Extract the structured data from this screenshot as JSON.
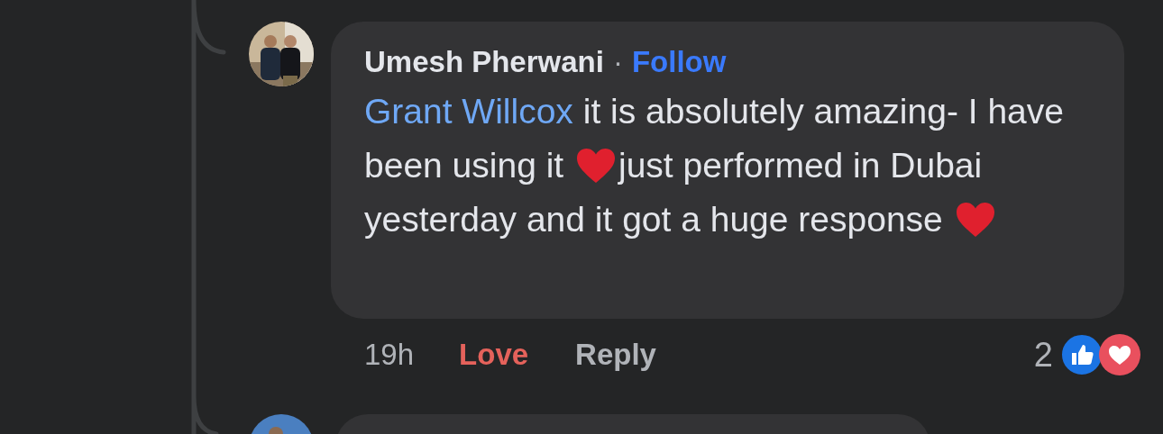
{
  "comment": {
    "author": "Umesh Pherwani",
    "separator": "·",
    "follow": "Follow",
    "body": [
      {
        "kind": "mention",
        "text": "Grant Willcox"
      },
      {
        "kind": "text",
        "text": " it is absolutely amazing- I have been using it "
      },
      {
        "kind": "heart"
      },
      {
        "kind": "text",
        "text": "just performed in Dubai yesterday and it got a huge response "
      },
      {
        "kind": "heart"
      }
    ],
    "time": "19h",
    "actions": [
      {
        "label": "Love",
        "kind": "reaction",
        "selected": true
      },
      {
        "label": "Reply",
        "kind": "reply",
        "selected": false
      }
    ],
    "reaction_count": "2",
    "reactions": [
      {
        "kind": "like"
      },
      {
        "kind": "love"
      }
    ]
  }
}
